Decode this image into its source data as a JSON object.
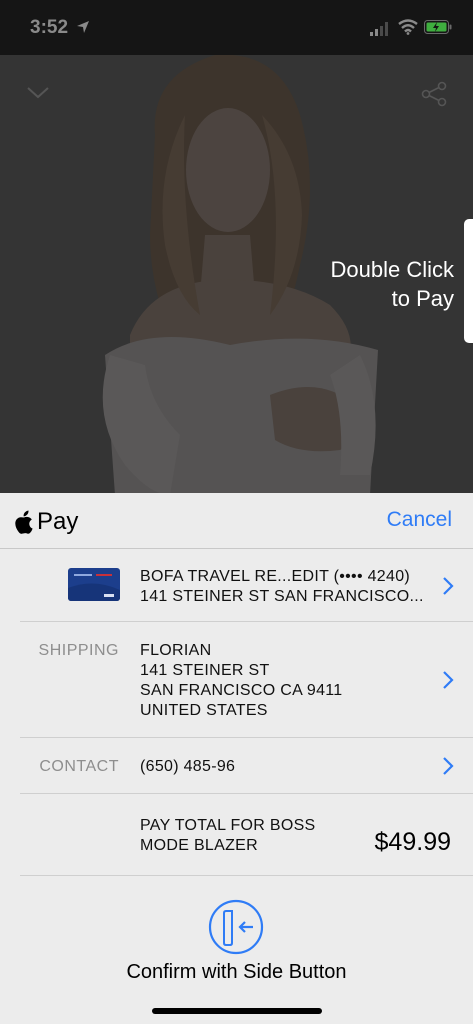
{
  "status_bar": {
    "time": "3:52"
  },
  "overlay": {
    "double_click_line1": "Double Click",
    "double_click_line2": "to Pay"
  },
  "sheet": {
    "pay_label": "Pay",
    "cancel_label": "Cancel",
    "card": {
      "name": "BOFA TRAVEL RE...EDIT (•••• 4240)",
      "address": "141   STEINER ST SAN FRANCISCO..."
    },
    "shipping": {
      "label": "SHIPPING",
      "name": "FLORIAN",
      "street": "141   STEINER ST",
      "city": "SAN FRANCISCO CA 9411",
      "country": "UNITED STATES"
    },
    "contact": {
      "label": "CONTACT",
      "value": "(650) 485-96"
    },
    "total": {
      "line1": "PAY TOTAL FOR BOSS",
      "line2": "MODE BLAZER",
      "amount": "$49.99"
    },
    "confirm_label": "Confirm with Side Button"
  },
  "colors": {
    "accent": "#2f7cf6",
    "sheet_bg": "#ececec",
    "dimmed_photo_bg": "#343434"
  }
}
